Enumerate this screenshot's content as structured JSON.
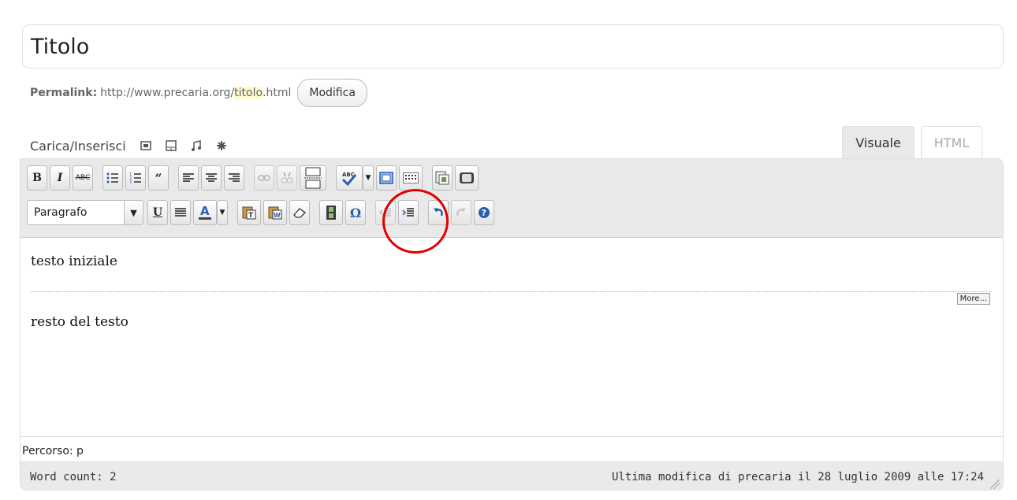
{
  "post": {
    "title": "Titolo"
  },
  "permalink": {
    "label": "Permalink:",
    "base_url": "http://www.precaria.org/",
    "slug": "titolo",
    "suffix": ".html",
    "edit_label": "Modifica"
  },
  "media": {
    "label": "Carica/Inserisci",
    "icons": [
      "image-icon",
      "video-icon",
      "audio-icon",
      "media-icon"
    ]
  },
  "tabs": {
    "visual": "Visuale",
    "html": "HTML",
    "active": "Visuale"
  },
  "toolbar": {
    "row1": [
      "bold",
      "italic",
      "strikethrough",
      "bullet-list",
      "numbered-list",
      "blockquote",
      "align-left",
      "align-center",
      "align-right",
      "link",
      "unlink",
      "insert-more",
      "spellcheck",
      "fullscreen",
      "kitchen-sink",
      "insert-image",
      "insert-video"
    ],
    "format_select": "Paragrafo",
    "row2": [
      "underline",
      "justify",
      "text-color",
      "paste-text",
      "paste-word",
      "remove-format",
      "insert-media",
      "special-character",
      "outdent",
      "indent",
      "undo",
      "redo",
      "help"
    ],
    "highlighted_button": "insert-media"
  },
  "content": {
    "paragraph1": "testo iniziale",
    "more_tag": "More...",
    "paragraph2": "resto del testo"
  },
  "status": {
    "path": "Percorso: p",
    "word_count": "Word count: 2",
    "last_modified": "Ultima modifica di precaria il 28 luglio 2009 alle 17:24"
  },
  "colors": {
    "highlight": "#e30000",
    "toolbar_bg": "#e9e9e9",
    "slug_bg": "#fffbcc"
  }
}
